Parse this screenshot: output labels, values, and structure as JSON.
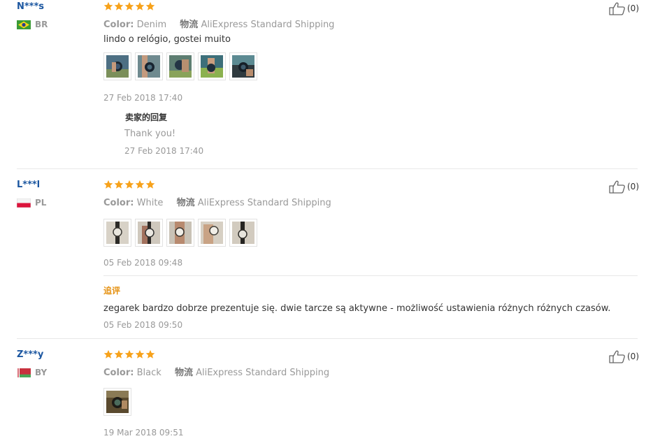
{
  "rating_color": "#f7a21b",
  "reviews": [
    {
      "buyer": "N***s",
      "country": "BR",
      "flag": "brazil-flag",
      "stars": 5,
      "color_label": "Color:",
      "color_value": "Denim",
      "shipping_label": "物流",
      "shipping_value": "AliExpress Standard Shipping",
      "text": "lindo o relógio, gostei muito",
      "photo_count": 5,
      "date": "27 Feb 2018 17:40",
      "seller_reply": {
        "title": "卖家的回复",
        "text": "Thank you!",
        "date": "27 Feb 2018 17:40"
      },
      "helpful": "(0)"
    },
    {
      "buyer": "L***l",
      "country": "PL",
      "flag": "poland-flag",
      "stars": 5,
      "color_label": "Color:",
      "color_value": "White",
      "shipping_label": "物流",
      "shipping_value": "AliExpress Standard Shipping",
      "photo_count": 5,
      "date": "05 Feb 2018 09:48",
      "additional": {
        "label": "追评",
        "text": "zegarek bardzo dobrze prezentuje się. dwie tarcze są aktywne - możliwość ustawienia różnych różnych czasów.",
        "date": "05 Feb 2018 09:50"
      },
      "helpful": "(0)"
    },
    {
      "buyer": "Z***y",
      "country": "BY",
      "flag": "belarus-flag",
      "stars": 5,
      "color_label": "Color:",
      "color_value": "Black",
      "shipping_label": "物流",
      "shipping_value": "AliExpress Standard Shipping",
      "photo_count": 1,
      "date": "19 Mar 2018 09:51",
      "helpful": "(0)"
    }
  ]
}
